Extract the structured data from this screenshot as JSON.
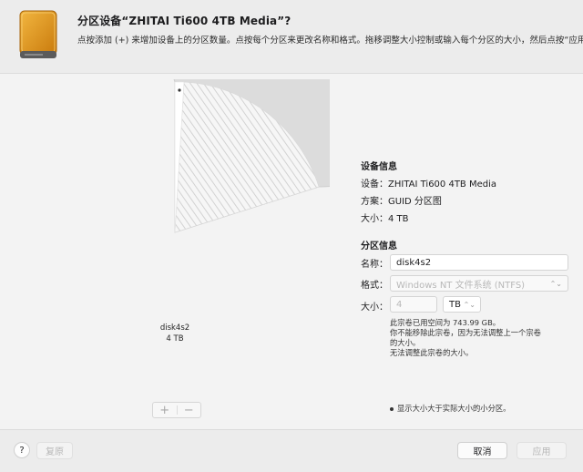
{
  "header": {
    "title": "分区设备“ZHITAI Ti600 4TB Media”?",
    "subtitle": "点按添加 (+) 来增加设备上的分区数量。点按每个分区来更改名称和格式。拖移调整大小控制或输入每个分区的大小，然后点按“应用”。"
  },
  "pie": {
    "partition_name": "disk4s2",
    "partition_size": "4 TB",
    "add_label": "+",
    "remove_label": "−"
  },
  "device_info": {
    "section_title": "设备信息",
    "device": "设备：ZHITAI Ti600 4TB Media",
    "scheme": "方案：GUID 分区图",
    "size": "大小：4 TB"
  },
  "partition_info": {
    "section_title": "分区信息",
    "name_label": "名称：",
    "name_value": "disk4s2",
    "format_label": "格式：",
    "format_value": "Windows NT 文件系统 (NTFS)",
    "size_label": "大小：",
    "size_value": "4",
    "unit_value": "TB",
    "note_line1": "此宗卷已用空间为 743.99 GB。",
    "note_line2": "你不能移除此宗卷，因为无法调整上一个宗卷",
    "note_line3": "的大小。",
    "note_line4": "无法调整此宗卷的大小。",
    "legend": "显示大小大于实际大小的小分区。"
  },
  "footer": {
    "help_label": "?",
    "revert_label": "复原",
    "cancel_label": "取消",
    "apply_label": "应用"
  },
  "colors": {
    "drive_orange": "#e39a1b",
    "pie_fill": "#dcdcdc",
    "hatch_line": "#cfcfcf"
  }
}
